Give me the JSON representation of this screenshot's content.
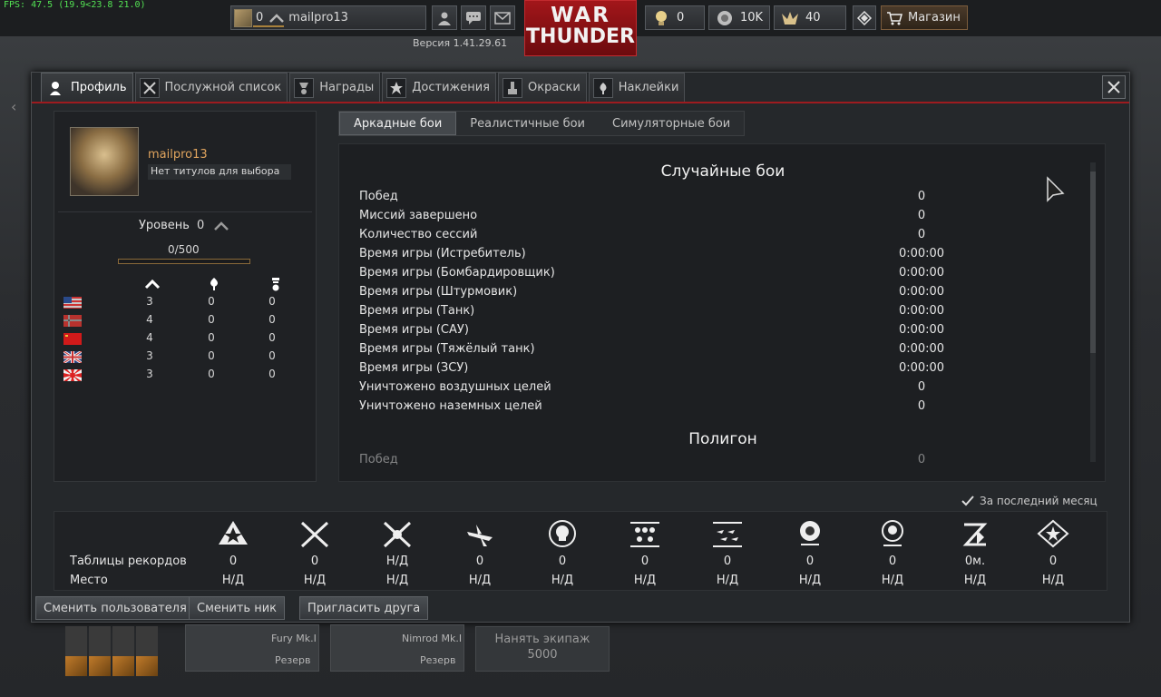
{
  "fps": "FPS: 47.5 (19.9<23.8 21.0)",
  "topbar": {
    "level": "0",
    "username": "mailpro13",
    "version": "Версия 1.41.29.61",
    "logo_line1": "WAR",
    "logo_line2": "THUNDER",
    "research": "0",
    "silver": "10K",
    "gold": "40",
    "shop_label": "Магазин"
  },
  "tabs": [
    {
      "label": "Профиль",
      "icon": "pilot-icon"
    },
    {
      "label": "Послужной список",
      "icon": "service-record-icon"
    },
    {
      "label": "Награды",
      "icon": "awards-icon"
    },
    {
      "label": "Достижения",
      "icon": "achievements-icon"
    },
    {
      "label": "Окраски",
      "icon": "paint-icon"
    },
    {
      "label": "Наклейки",
      "icon": "decals-icon"
    }
  ],
  "profile": {
    "name": "mailpro13",
    "title": "Нет титулов для выбора",
    "level_label": "Уровень",
    "level_value": "0",
    "experience": "0/500",
    "experience_fraction": 0,
    "countries": [
      {
        "flag": "usa-flag",
        "c1": "3",
        "c2": "0",
        "c3": "0"
      },
      {
        "flag": "germany-flag",
        "c1": "4",
        "c2": "0",
        "c3": "0"
      },
      {
        "flag": "ussr-flag",
        "c1": "4",
        "c2": "0",
        "c3": "0"
      },
      {
        "flag": "britain-flag",
        "c1": "3",
        "c2": "0",
        "c3": "0"
      },
      {
        "flag": "japan-flag",
        "c1": "3",
        "c2": "0",
        "c3": "0"
      }
    ]
  },
  "modes": [
    "Аркадные бои",
    "Реалистичные бои",
    "Симуляторные бои"
  ],
  "stats": {
    "section1": "Случайные бои",
    "rows": [
      {
        "label": "Побед",
        "value": "0"
      },
      {
        "label": "Миссий завершено",
        "value": "0"
      },
      {
        "label": "Количество сессий",
        "value": "0"
      },
      {
        "label": "Время игры (Истребитель)",
        "value": "0:00:00"
      },
      {
        "label": "Время игры (Бомбардировщик)",
        "value": "0:00:00"
      },
      {
        "label": "Время игры (Штурмовик)",
        "value": "0:00:00"
      },
      {
        "label": "Время игры (Танк)",
        "value": "0:00:00"
      },
      {
        "label": "Время игры (САУ)",
        "value": "0:00:00"
      },
      {
        "label": "Время игры (Тяжёлый танк)",
        "value": "0:00:00"
      },
      {
        "label": "Время игры (ЗСУ)",
        "value": "0:00:00"
      },
      {
        "label": "Уничтожено воздушных целей",
        "value": "0"
      },
      {
        "label": "Уничтожено наземных целей",
        "value": "0"
      }
    ],
    "section2": "Полигон",
    "partial_row": {
      "label": "Побед",
      "value": "0"
    }
  },
  "last_month": "За последний месяц",
  "leaderboard": {
    "row1_label": "Таблицы рекордов",
    "row2_label": "Место",
    "columns": [
      {
        "icon": "star-victories-icon",
        "v1": "0",
        "v2": "Н/Д"
      },
      {
        "icon": "crossed-swords-icon",
        "v1": "0",
        "v2": "Н/Д"
      },
      {
        "icon": "crossed-swords-star-icon",
        "v1": "Н/Д",
        "v2": "Н/Д"
      },
      {
        "icon": "plane-kills-icon",
        "v1": "0",
        "v2": "Н/Д"
      },
      {
        "icon": "skull-icon",
        "v1": "0",
        "v2": "Н/Д"
      },
      {
        "icon": "three-stars-icon",
        "v1": "0",
        "v2": "Н/Д"
      },
      {
        "icon": "planes-formation-icon",
        "v1": "0",
        "v2": "Н/Д"
      },
      {
        "icon": "lion-icon",
        "v1": "0",
        "v2": "Н/Д"
      },
      {
        "icon": "lightbulb-icon",
        "v1": "0",
        "v2": "Н/Д"
      },
      {
        "icon": "time-flyer-icon",
        "v1": "0м.",
        "v2": "Н/Д"
      },
      {
        "icon": "shield-star-icon",
        "v1": "0",
        "v2": "Н/Д"
      }
    ]
  },
  "buttons": {
    "change_user": "Сменить пользователя",
    "change_nick": "Сменить ник",
    "invite": "Пригласить друга"
  },
  "hangar": {
    "slot1_name": "Fury Mk.I",
    "slot1_status": "Резерв",
    "slot2_name": "Nimrod Mk.I",
    "slot2_status": "Резерв",
    "hire_label": "Нанять экипаж",
    "hire_cost": "5000"
  }
}
